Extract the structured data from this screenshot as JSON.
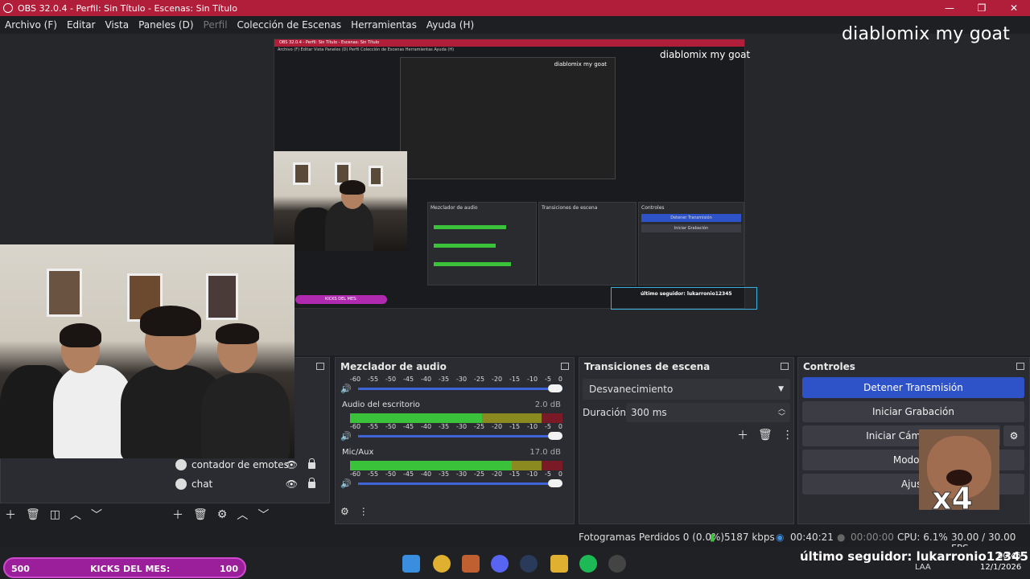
{
  "window": {
    "title": "OBS 32.0.4 - Perfil: Sin Título - Escenas: Sin Título",
    "minimize": "—",
    "maximize": "❐",
    "close": "✕"
  },
  "menu": [
    "Archivo (F)",
    "Editar",
    "Vista",
    "Paneles (D)",
    "Perfil",
    "Colección de Escenas",
    "Herramientas",
    "Ayuda (H)"
  ],
  "preview": {
    "overlay_text": "diablomix my goat",
    "nested": {
      "title": "OBS 32.0.4 - Perfil: Sin Título - Escenas: Sin Título",
      "menu": "Archivo (F)   Editar   Vista   Paneles (D)   Perfil   Colección de Escenas   Herramientas   Ayuda (H)",
      "overlay": "diablomix my goat",
      "mixer": "Mezclador de audio",
      "transitions": "Transiciones de escena",
      "controls": "Controles",
      "stop": "Detener Transmisión",
      "record": "Iniciar Grabación",
      "kicks": "KICKS DEL MES:",
      "follower": "último seguidor: lukarronio12345"
    }
  },
  "sources": {
    "items": [
      {
        "label": "contador de emotes"
      },
      {
        "label": "chat"
      }
    ]
  },
  "mixer": {
    "title": "Mezclador de audio",
    "scale": [
      "-60",
      "-55",
      "-50",
      "-45",
      "-40",
      "-35",
      "-30",
      "-25",
      "-20",
      "-15",
      "-10",
      "-5",
      "0"
    ],
    "channels": [
      {
        "name": "Audio del escritorio",
        "db": "2.0 dB",
        "level": 0.42
      },
      {
        "name": "Mic/Aux",
        "db": "17.0 dB",
        "level": 0.5
      }
    ]
  },
  "transitions": {
    "title": "Transiciones de escena",
    "selected": "Desvanecimiento",
    "duration_label": "Duración",
    "duration": "300 ms"
  },
  "controls": {
    "title": "Controles",
    "stop_stream": "Detener Transmisión",
    "start_record": "Iniciar Grabación",
    "start_camera": "Iniciar Cámara",
    "studio_mode": "Modo Es",
    "settings": "Ajust"
  },
  "status": {
    "dropped": "Fotogramas Perdidos 0 (0.0%)",
    "bitrate": "5187 kbps",
    "stream_time": "00:40:21",
    "record_time": "00:00:00",
    "cpu": "CPU: 6.1%",
    "fps": "30.00 / 30.00 FPS"
  },
  "overlays": {
    "kicks_left": "500",
    "kicks_label": "KICKS DEL MES:",
    "kicks_right": "100",
    "follower": "último seguidor: lukarronio12345",
    "meme": "x4"
  },
  "taskbar": {
    "time": "00:46",
    "date": "12/1/2026",
    "lang": "LAA"
  },
  "colors": {
    "titlebar": "#b01e3a",
    "accent": "#2e52c7",
    "meter_green": "#3ac23a",
    "kicks": "#9b1e9b"
  }
}
